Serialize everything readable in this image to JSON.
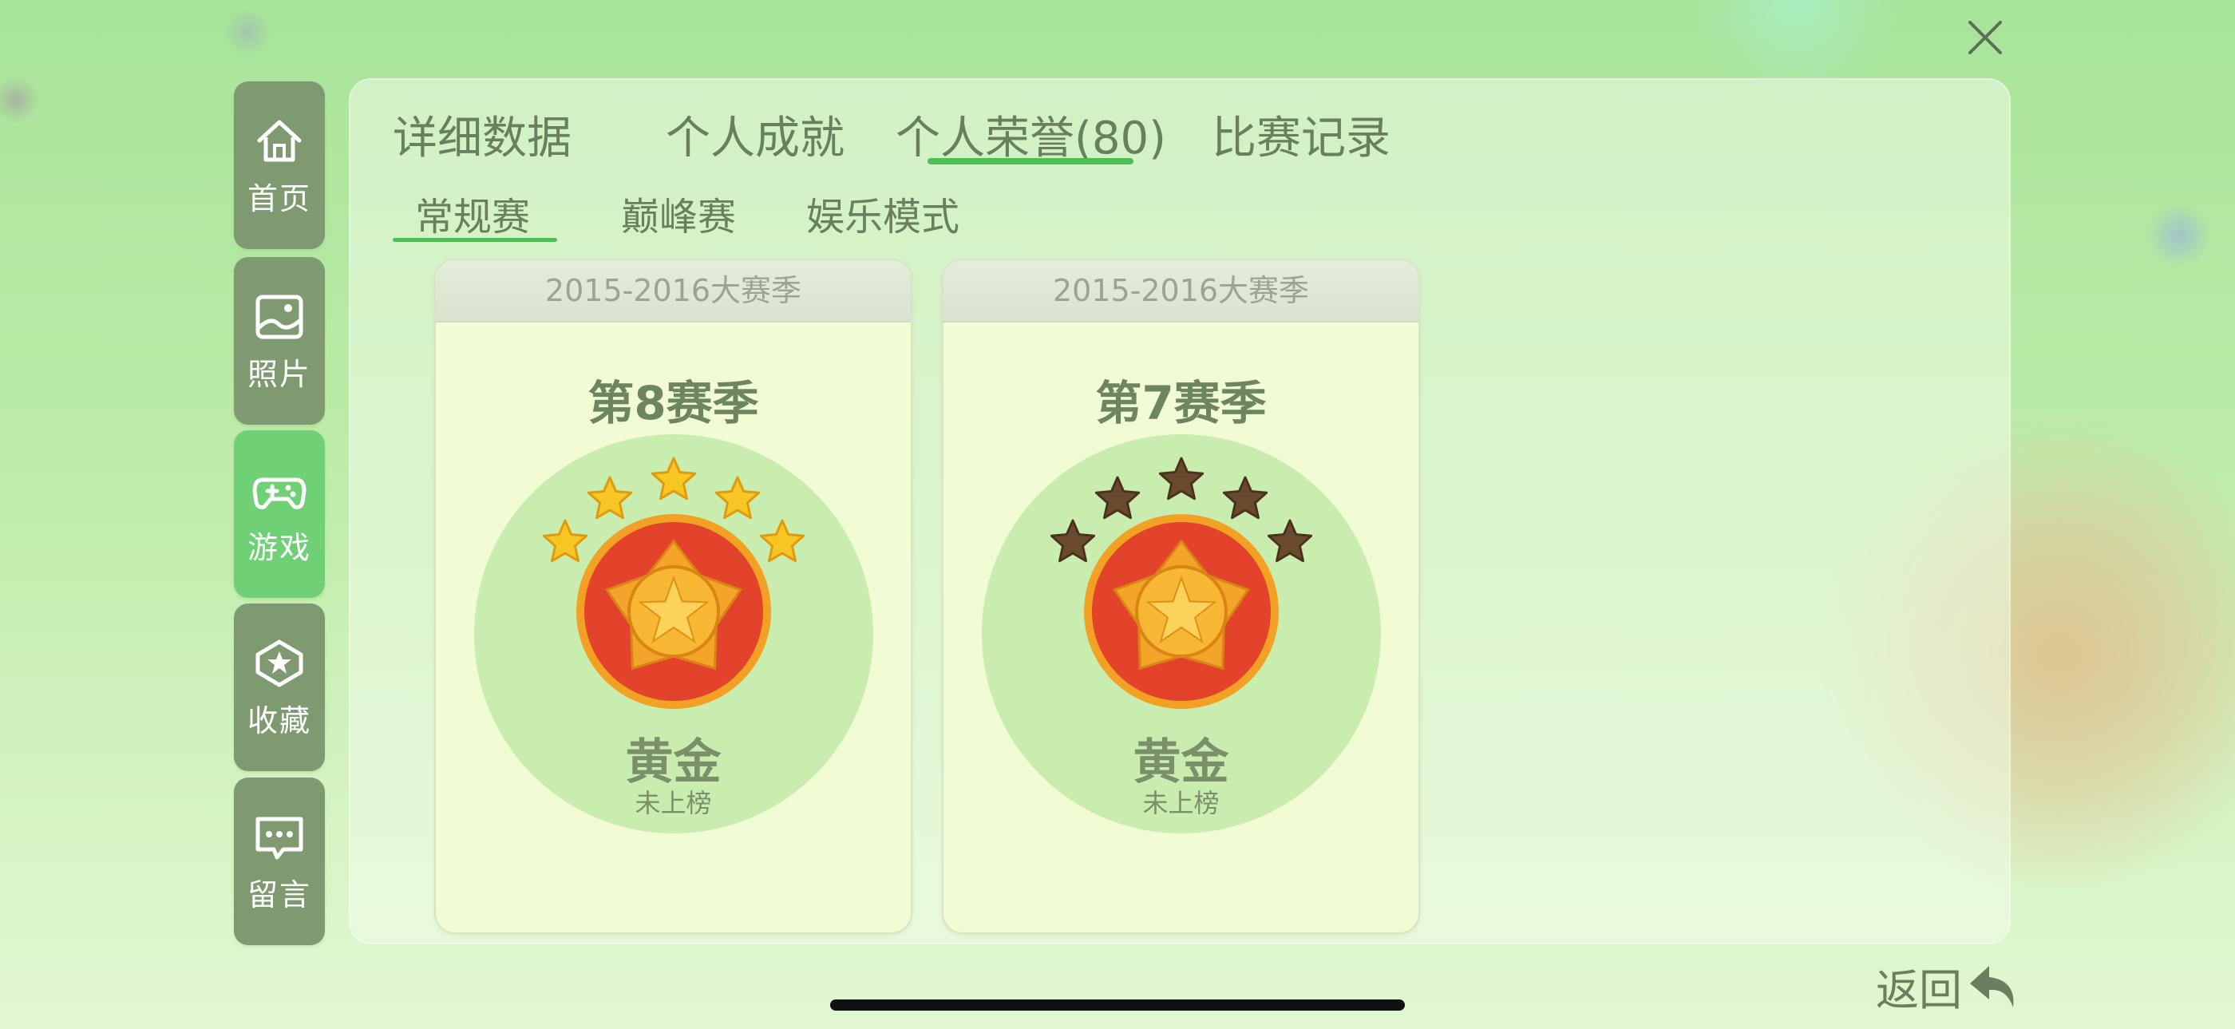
{
  "close": {
    "icon": "close-icon"
  },
  "sidebar": {
    "items": [
      {
        "label": "首页",
        "icon": "home-icon",
        "active": false
      },
      {
        "label": "照片",
        "icon": "photo-icon",
        "active": false
      },
      {
        "label": "游戏",
        "icon": "gamepad-icon",
        "active": true
      },
      {
        "label": "收藏",
        "icon": "star-badge-icon",
        "active": false
      },
      {
        "label": "留言",
        "icon": "message-icon",
        "active": false
      }
    ]
  },
  "tabs": [
    {
      "label": "详细数据"
    },
    {
      "label": "个人成就"
    },
    {
      "label": "个人荣誉(80)",
      "active": true
    },
    {
      "label": "比赛记录"
    }
  ],
  "subtabs": [
    {
      "label": "常规赛",
      "active": true
    },
    {
      "label": "巅峰赛"
    },
    {
      "label": "娱乐模式"
    }
  ],
  "cards": [
    {
      "header": "2015-2016大赛季",
      "season": "第8赛季",
      "rank": "黄金",
      "status": "未上榜",
      "stars_lit": 5,
      "stars_total": 5
    },
    {
      "header": "2015-2016大赛季",
      "season": "第7赛季",
      "rank": "黄金",
      "status": "未上榜",
      "stars_lit": 0,
      "stars_total": 5
    }
  ],
  "back": {
    "label": "返回",
    "icon": "back-arrow-icon"
  },
  "colors": {
    "accent": "#4fbf55",
    "sidebar": "#7f9a70",
    "sidebar_active": "#6fd075",
    "text": "#6a7f5e",
    "star_lit": "#f7c623",
    "star_dim": "#6a4a2e",
    "medal_red": "#e2432a",
    "medal_gold": "#f3a52a"
  }
}
